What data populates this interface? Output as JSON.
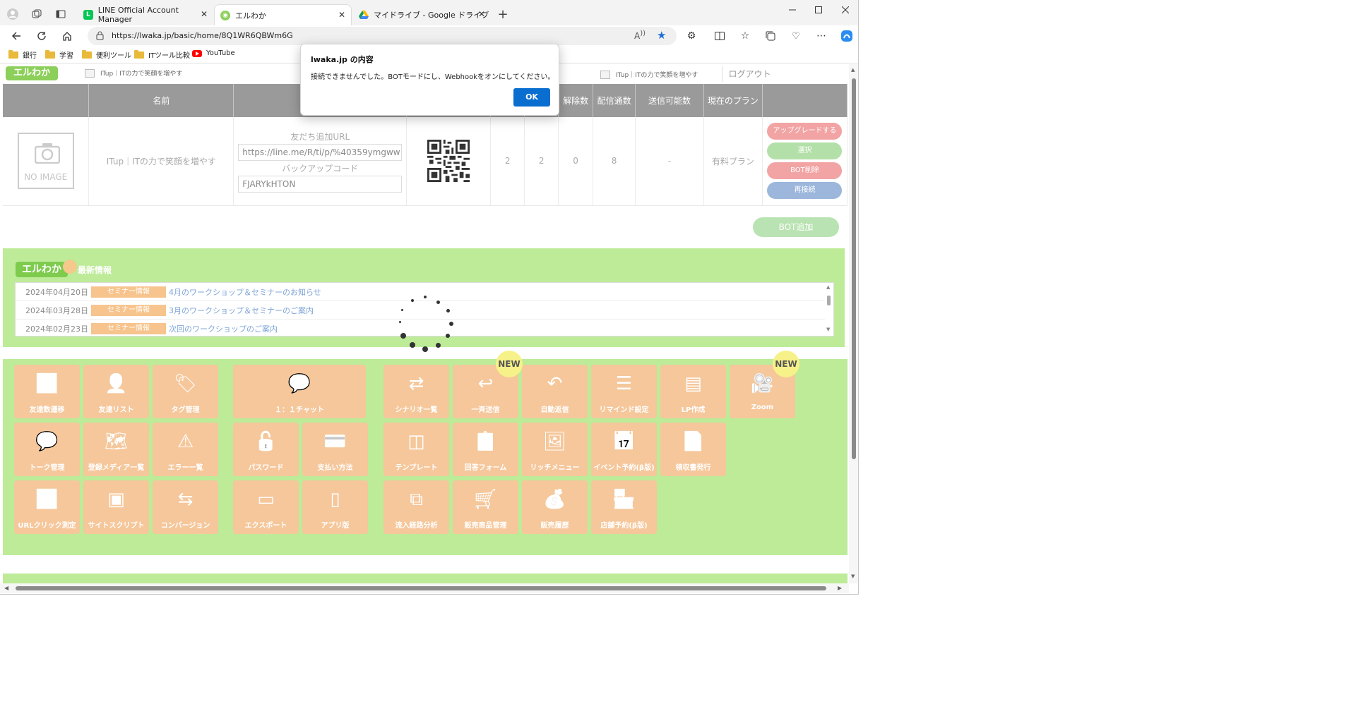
{
  "browser": {
    "tabs": [
      {
        "label": "LINE Official Account Manager",
        "active": false
      },
      {
        "label": "エルわか",
        "active": true
      },
      {
        "label": "マイドライブ - Google ドライブ",
        "active": false
      }
    ],
    "new_tab": "+",
    "url": "https://lwaka.jp/basic/home/8Q1WR6QBWm6G",
    "bookmarks": [
      "銀行",
      "学習",
      "便利ツール",
      "ITツール比較",
      "YouTube"
    ]
  },
  "header": {
    "logo": "エルわか",
    "account_name_left": "ITup｜ITの力で笑顔を増やす",
    "account_name_right": "ITup｜ITの力で笑顔を増やす",
    "logout": "ログアウト"
  },
  "table": {
    "headers": [
      "",
      "名前",
      "",
      "",
      "",
      "",
      "解除数",
      "配信通数",
      "送信可能数",
      "現在のプラン",
      ""
    ],
    "row": {
      "image_label": "NO IMAGE",
      "name": "ITup｜ITの力で笑顔を増やす",
      "friend_url_label": "友だち追加URL",
      "friend_url_value": "https://line.me/R/ti/p/%40359ymgww",
      "backup_code_label": "バックアップコード",
      "backup_code_value": "FJARYkHTON",
      "col_a": "2",
      "col_b": "2",
      "unsub": "0",
      "delivered": "8",
      "sendable": "-",
      "plan": "有料プラン",
      "buttons": {
        "upgrade": "アップグレードする",
        "select": "選択",
        "delete": "BOT削除",
        "reconnect": "再接続"
      }
    },
    "bot_add": "BOT追加"
  },
  "news": {
    "logo": "エルわか",
    "heading": "最新情報",
    "items": [
      {
        "date": "2024年04月20日",
        "tag": "セミナー情報",
        "title": "4月のワークショップ＆セミナーのお知らせ"
      },
      {
        "date": "2024年03月28日",
        "tag": "セミナー情報",
        "title": "3月のワークショップ＆セミナーのご案内"
      },
      {
        "date": "2024年02月23日",
        "tag": "セミナー情報",
        "title": "次回のワークショップのご案内"
      }
    ]
  },
  "menu": {
    "new_badge": "NEW",
    "items": [
      {
        "label": "友達数遷移",
        "icon": "chart-line-icon"
      },
      {
        "label": "友達リスト",
        "icon": "user-icon"
      },
      {
        "label": "タグ管理",
        "icon": "tag-icon"
      },
      {
        "label": "１：１チャット",
        "icon": "chat-bubble-icon"
      },
      {
        "label": "シナリオ一覧",
        "icon": "shuffle-icon"
      },
      {
        "label": "一斉送信",
        "icon": "reply-icon"
      },
      {
        "label": "自動返信",
        "icon": "undo-icon"
      },
      {
        "label": "リマインド設定",
        "icon": "list-icon"
      },
      {
        "label": "LP作成",
        "icon": "web-page-icon"
      },
      {
        "label": "Zoom",
        "icon": "video-camera-icon"
      },
      {
        "label": "トーク管理",
        "icon": "speech-bubble-icon"
      },
      {
        "label": "登録メディア一覧",
        "icon": "map-icon"
      },
      {
        "label": "エラー一覧",
        "icon": "warning-icon"
      },
      {
        "label": "パスワード",
        "icon": "lock-icon"
      },
      {
        "label": "支払い方法",
        "icon": "credit-card-icon"
      },
      {
        "label": "テンプレート",
        "icon": "columns-icon"
      },
      {
        "label": "回答フォーム",
        "icon": "clipboard-edit-icon"
      },
      {
        "label": "リッチメニュー",
        "icon": "image-icon"
      },
      {
        "label": "イベント予約(β版)",
        "icon": "calendar-icon"
      },
      {
        "label": "領収書発行",
        "icon": "document-icon"
      },
      {
        "label": "URLクリック測定",
        "icon": "bar-search-icon"
      },
      {
        "label": "サイトスクリプト",
        "icon": "browser-window-icon"
      },
      {
        "label": "コンバージョン",
        "icon": "exchange-icon"
      },
      {
        "label": "エクスポート",
        "icon": "hard-drive-icon"
      },
      {
        "label": "アプリ版",
        "icon": "smartphone-icon"
      },
      {
        "label": "流入経路分析",
        "icon": "sitemap-icon"
      },
      {
        "label": "販売商品管理",
        "icon": "cart-icon"
      },
      {
        "label": "販売履歴",
        "icon": "money-bag-icon"
      },
      {
        "label": "店舗予約(β版)",
        "icon": "store-icon"
      }
    ]
  },
  "dialog": {
    "title": "lwaka.jp の内容",
    "message": "接続できませんでした。BOTモードにし、Webhookをオンにしてください。",
    "ok": "OK"
  },
  "colors": {
    "accent_blue": "#0a6ed1",
    "menu_tile": "#f5c79b",
    "panel_green": "#bdeb98",
    "news_tag": "#f7c48d"
  }
}
